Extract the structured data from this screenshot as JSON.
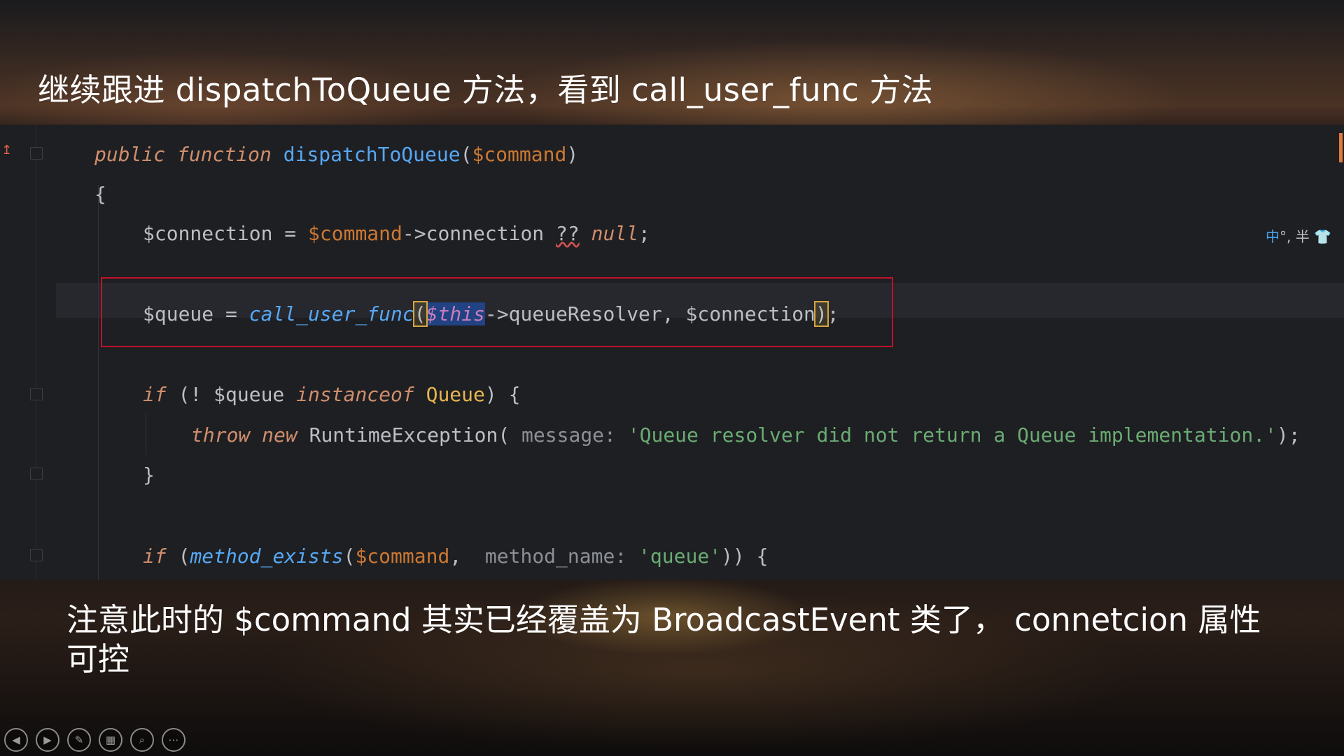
{
  "slide": {
    "title": "继续跟进 dispatchToQueue 方法，看到 call_user_func 方法",
    "subtitle": "注意此时的 $command 其实已经覆盖为 BroadcastEvent 类了， connetcion 属性可控"
  },
  "code": {
    "l1": {
      "kw1": "public",
      "kw2": "function",
      "fn": "dispatchToQueue",
      "open": "(",
      "param": "$command",
      "close": ")"
    },
    "l2": {
      "brace": "{"
    },
    "l3": {
      "var": "$connection",
      "eq": " = ",
      "param": "$command",
      "arrow": "->connection ",
      "coalesce": "??",
      "space": " ",
      "null": "null",
      "semi": ";"
    },
    "l4": {
      "var": "$queue",
      "eq": " = ",
      "fn": "call_user_func",
      "open": "(",
      "this": "$this",
      "rest": "->queueResolver, $connection",
      "close": ")",
      "semi": ";"
    },
    "l5": {
      "kw": "if",
      "pre": " (! $queue ",
      "inst": "instanceof",
      "sp": " ",
      "cls": "Queue",
      "post": ") {"
    },
    "l6": {
      "kw1": "throw",
      "kw2": "new",
      "cls": "RuntimeException",
      "open": "(",
      "hint": " message: ",
      "str": "'Queue resolver did not return a Queue implementation.'",
      "close": ");"
    },
    "l7": {
      "brace": "}"
    },
    "l8": {
      "kw": "if",
      "open": " (",
      "fn": "method_exists",
      "p1": "(",
      "param": "$command",
      "comma": ",",
      "hint": "  method_name: ",
      "str": "'queue'",
      "close": ")) {"
    }
  },
  "ime": {
    "zh": "中",
    "rest": "°, 半 👕"
  },
  "controls": [
    {
      "name": "previous-icon",
      "glyph": "◀"
    },
    {
      "name": "next-icon",
      "glyph": "▶"
    },
    {
      "name": "pen-icon",
      "glyph": "✎"
    },
    {
      "name": "slides-grid-icon",
      "glyph": "▦"
    },
    {
      "name": "zoom-icon",
      "glyph": "⌕"
    },
    {
      "name": "more-icon",
      "glyph": "⋯"
    }
  ]
}
